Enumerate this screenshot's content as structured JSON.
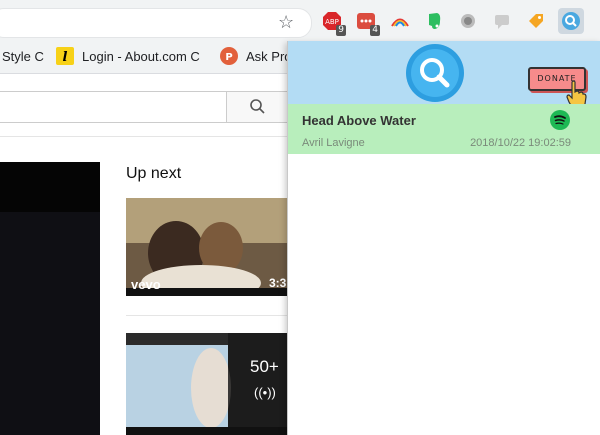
{
  "toolbar": {
    "extensions": [
      {
        "name": "adblock",
        "label": "ABP",
        "badge": "9"
      },
      {
        "name": "todoist",
        "label": "•••",
        "badge": "4"
      },
      {
        "name": "rainbow",
        "label": ""
      },
      {
        "name": "evernote",
        "label": ""
      },
      {
        "name": "extension-gray",
        "label": ""
      },
      {
        "name": "extension-chat",
        "label": ""
      },
      {
        "name": "extension-tag",
        "label": ""
      },
      {
        "name": "song-finder",
        "label": ""
      }
    ]
  },
  "bookmarks": [
    {
      "label": "Style C"
    },
    {
      "label": "Login - About.com C"
    },
    {
      "label": "Ask Pro"
    }
  ],
  "page": {
    "up_next": "Up next",
    "video1": {
      "brand": "vevo",
      "duration": "3:3"
    },
    "video2": {
      "count": "50+",
      "icon": "((•))"
    }
  },
  "popup": {
    "donate_label": "DONATE",
    "song": {
      "title": "Head Above Water",
      "artist": "Avril Lavigne",
      "timestamp": "2018/10/22 19:02:59",
      "service": "spotify"
    }
  },
  "colors": {
    "popup_header": "#b3dcf4",
    "song_row": "#b8eebc",
    "donate": "#f78b8b",
    "spotify": "#1db954"
  }
}
